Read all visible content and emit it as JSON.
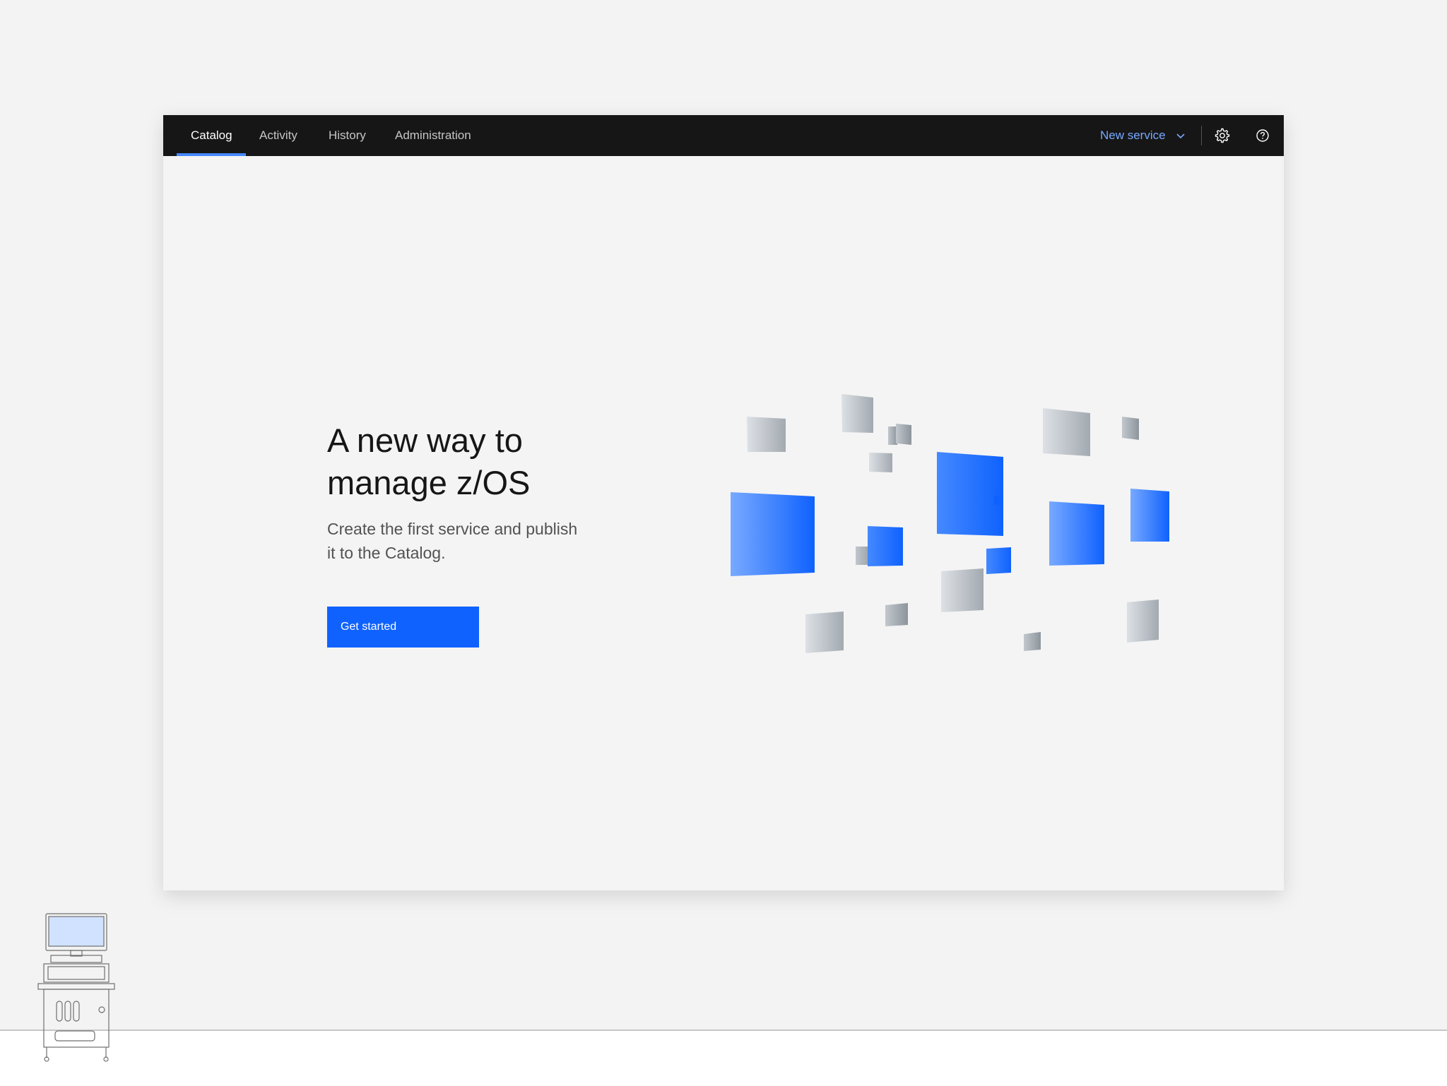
{
  "nav": {
    "tabs": [
      {
        "label": "Catalog",
        "active": true
      },
      {
        "label": "Activity",
        "active": false
      },
      {
        "label": "History",
        "active": false
      },
      {
        "label": "Administration",
        "active": false
      }
    ],
    "new_service_label": "New service",
    "icons": [
      "chevron-down-icon",
      "settings-icon",
      "help-icon"
    ]
  },
  "hero": {
    "title_line1": "A new way to",
    "title_line2": "manage z/OS",
    "subtitle_line1": "Create the first service and publish",
    "subtitle_line2": "it to the Catalog.",
    "cta_label": "Get started"
  },
  "colors": {
    "nav_bg": "#161616",
    "accent": "#0f62fe",
    "link": "#78a9ff",
    "active_tab": "#4589ff",
    "page_bg": "#f4f4f4"
  },
  "decoration": {
    "illustration": "floating-squares-illustration",
    "corner_icon": "ultrasound-machine-icon"
  }
}
